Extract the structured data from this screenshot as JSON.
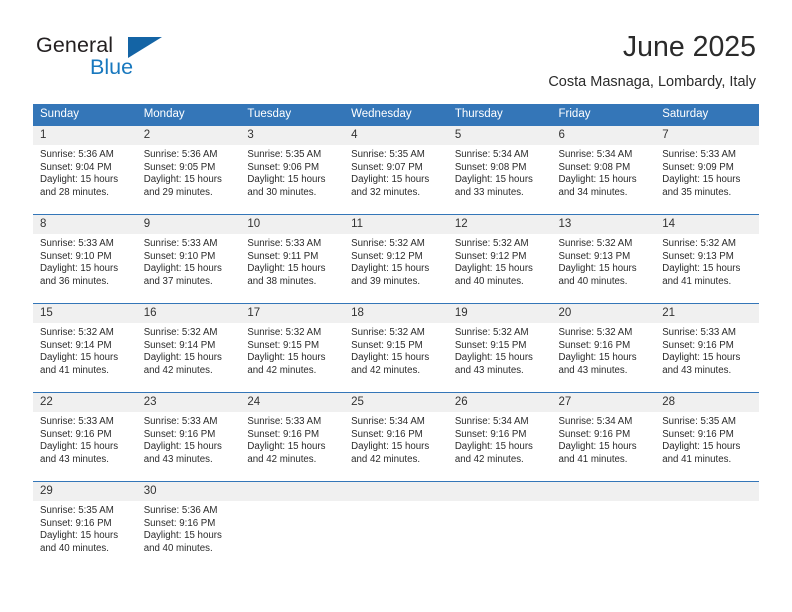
{
  "brand": {
    "name_part1": "General",
    "name_part2": "Blue",
    "flag_icon": "triangle-flag-icon"
  },
  "header": {
    "title": "June 2025",
    "location": "Costa Masnaga, Lombardy, Italy"
  },
  "calendar": {
    "weekday_headers": [
      "Sunday",
      "Monday",
      "Tuesday",
      "Wednesday",
      "Thursday",
      "Friday",
      "Saturday"
    ],
    "accent_color": "#3476b8",
    "daynum_bg": "#f0f0f0",
    "weeks": [
      [
        {
          "day": "1",
          "sunrise": "Sunrise: 5:36 AM",
          "sunset": "Sunset: 9:04 PM",
          "daylight": "Daylight: 15 hours and 28 minutes."
        },
        {
          "day": "2",
          "sunrise": "Sunrise: 5:36 AM",
          "sunset": "Sunset: 9:05 PM",
          "daylight": "Daylight: 15 hours and 29 minutes."
        },
        {
          "day": "3",
          "sunrise": "Sunrise: 5:35 AM",
          "sunset": "Sunset: 9:06 PM",
          "daylight": "Daylight: 15 hours and 30 minutes."
        },
        {
          "day": "4",
          "sunrise": "Sunrise: 5:35 AM",
          "sunset": "Sunset: 9:07 PM",
          "daylight": "Daylight: 15 hours and 32 minutes."
        },
        {
          "day": "5",
          "sunrise": "Sunrise: 5:34 AM",
          "sunset": "Sunset: 9:08 PM",
          "daylight": "Daylight: 15 hours and 33 minutes."
        },
        {
          "day": "6",
          "sunrise": "Sunrise: 5:34 AM",
          "sunset": "Sunset: 9:08 PM",
          "daylight": "Daylight: 15 hours and 34 minutes."
        },
        {
          "day": "7",
          "sunrise": "Sunrise: 5:33 AM",
          "sunset": "Sunset: 9:09 PM",
          "daylight": "Daylight: 15 hours and 35 minutes."
        }
      ],
      [
        {
          "day": "8",
          "sunrise": "Sunrise: 5:33 AM",
          "sunset": "Sunset: 9:10 PM",
          "daylight": "Daylight: 15 hours and 36 minutes."
        },
        {
          "day": "9",
          "sunrise": "Sunrise: 5:33 AM",
          "sunset": "Sunset: 9:10 PM",
          "daylight": "Daylight: 15 hours and 37 minutes."
        },
        {
          "day": "10",
          "sunrise": "Sunrise: 5:33 AM",
          "sunset": "Sunset: 9:11 PM",
          "daylight": "Daylight: 15 hours and 38 minutes."
        },
        {
          "day": "11",
          "sunrise": "Sunrise: 5:32 AM",
          "sunset": "Sunset: 9:12 PM",
          "daylight": "Daylight: 15 hours and 39 minutes."
        },
        {
          "day": "12",
          "sunrise": "Sunrise: 5:32 AM",
          "sunset": "Sunset: 9:12 PM",
          "daylight": "Daylight: 15 hours and 40 minutes."
        },
        {
          "day": "13",
          "sunrise": "Sunrise: 5:32 AM",
          "sunset": "Sunset: 9:13 PM",
          "daylight": "Daylight: 15 hours and 40 minutes."
        },
        {
          "day": "14",
          "sunrise": "Sunrise: 5:32 AM",
          "sunset": "Sunset: 9:13 PM",
          "daylight": "Daylight: 15 hours and 41 minutes."
        }
      ],
      [
        {
          "day": "15",
          "sunrise": "Sunrise: 5:32 AM",
          "sunset": "Sunset: 9:14 PM",
          "daylight": "Daylight: 15 hours and 41 minutes."
        },
        {
          "day": "16",
          "sunrise": "Sunrise: 5:32 AM",
          "sunset": "Sunset: 9:14 PM",
          "daylight": "Daylight: 15 hours and 42 minutes."
        },
        {
          "day": "17",
          "sunrise": "Sunrise: 5:32 AM",
          "sunset": "Sunset: 9:15 PM",
          "daylight": "Daylight: 15 hours and 42 minutes."
        },
        {
          "day": "18",
          "sunrise": "Sunrise: 5:32 AM",
          "sunset": "Sunset: 9:15 PM",
          "daylight": "Daylight: 15 hours and 42 minutes."
        },
        {
          "day": "19",
          "sunrise": "Sunrise: 5:32 AM",
          "sunset": "Sunset: 9:15 PM",
          "daylight": "Daylight: 15 hours and 43 minutes."
        },
        {
          "day": "20",
          "sunrise": "Sunrise: 5:32 AM",
          "sunset": "Sunset: 9:16 PM",
          "daylight": "Daylight: 15 hours and 43 minutes."
        },
        {
          "day": "21",
          "sunrise": "Sunrise: 5:33 AM",
          "sunset": "Sunset: 9:16 PM",
          "daylight": "Daylight: 15 hours and 43 minutes."
        }
      ],
      [
        {
          "day": "22",
          "sunrise": "Sunrise: 5:33 AM",
          "sunset": "Sunset: 9:16 PM",
          "daylight": "Daylight: 15 hours and 43 minutes."
        },
        {
          "day": "23",
          "sunrise": "Sunrise: 5:33 AM",
          "sunset": "Sunset: 9:16 PM",
          "daylight": "Daylight: 15 hours and 43 minutes."
        },
        {
          "day": "24",
          "sunrise": "Sunrise: 5:33 AM",
          "sunset": "Sunset: 9:16 PM",
          "daylight": "Daylight: 15 hours and 42 minutes."
        },
        {
          "day": "25",
          "sunrise": "Sunrise: 5:34 AM",
          "sunset": "Sunset: 9:16 PM",
          "daylight": "Daylight: 15 hours and 42 minutes."
        },
        {
          "day": "26",
          "sunrise": "Sunrise: 5:34 AM",
          "sunset": "Sunset: 9:16 PM",
          "daylight": "Daylight: 15 hours and 42 minutes."
        },
        {
          "day": "27",
          "sunrise": "Sunrise: 5:34 AM",
          "sunset": "Sunset: 9:16 PM",
          "daylight": "Daylight: 15 hours and 41 minutes."
        },
        {
          "day": "28",
          "sunrise": "Sunrise: 5:35 AM",
          "sunset": "Sunset: 9:16 PM",
          "daylight": "Daylight: 15 hours and 41 minutes."
        }
      ],
      [
        {
          "day": "29",
          "sunrise": "Sunrise: 5:35 AM",
          "sunset": "Sunset: 9:16 PM",
          "daylight": "Daylight: 15 hours and 40 minutes."
        },
        {
          "day": "30",
          "sunrise": "Sunrise: 5:36 AM",
          "sunset": "Sunset: 9:16 PM",
          "daylight": "Daylight: 15 hours and 40 minutes."
        },
        {
          "day": "",
          "sunrise": "",
          "sunset": "",
          "daylight": ""
        },
        {
          "day": "",
          "sunrise": "",
          "sunset": "",
          "daylight": ""
        },
        {
          "day": "",
          "sunrise": "",
          "sunset": "",
          "daylight": ""
        },
        {
          "day": "",
          "sunrise": "",
          "sunset": "",
          "daylight": ""
        },
        {
          "day": "",
          "sunrise": "",
          "sunset": "",
          "daylight": ""
        }
      ]
    ]
  }
}
